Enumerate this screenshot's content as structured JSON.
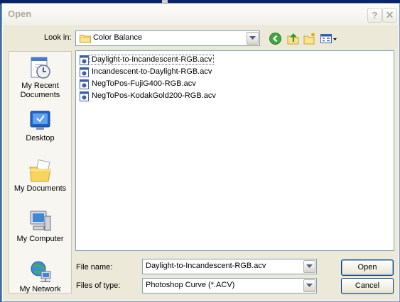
{
  "window": {
    "title": "Open",
    "help_glyph": "?",
    "close_glyph": "✕"
  },
  "lookin": {
    "label": "Look in:",
    "value": "Color Balance"
  },
  "toolbar": {
    "icons": [
      "back-icon",
      "up-folder-icon",
      "new-folder-icon",
      "views-menu-icon"
    ]
  },
  "places": [
    {
      "label_line1": "My Recent",
      "label_line2": "Documents",
      "icon": "recent-documents-icon"
    },
    {
      "label_line1": "Desktop",
      "label_line2": "",
      "icon": "desktop-icon"
    },
    {
      "label_line1": "My Documents",
      "label_line2": "",
      "icon": "my-documents-icon"
    },
    {
      "label_line1": "My Computer",
      "label_line2": "",
      "icon": "my-computer-icon"
    },
    {
      "label_line1": "My Network",
      "label_line2": "",
      "icon": "my-network-icon"
    }
  ],
  "files": [
    {
      "name": "Daylight-to-Incandescent-RGB.acv",
      "selected": true
    },
    {
      "name": "Incandescent-to-Daylight-RGB.acv",
      "selected": false
    },
    {
      "name": "NegToPos-FujiG400-RGB.acv",
      "selected": false
    },
    {
      "name": "NegToPos-KodakGold200-RGB.acv",
      "selected": false
    }
  ],
  "filename": {
    "label": "File name:",
    "value": "Daylight-to-Incandescent-RGB.acv"
  },
  "filetype": {
    "label": "Files of type:",
    "value": "Photoshop Curve (*.ACV)"
  },
  "buttons": {
    "open": "Open",
    "cancel": "Cancel"
  },
  "colors": {
    "title_bar": "#fdfdfd",
    "panel": "#ece9d8",
    "border": "#7f9db9",
    "title_text": "#aca899"
  }
}
